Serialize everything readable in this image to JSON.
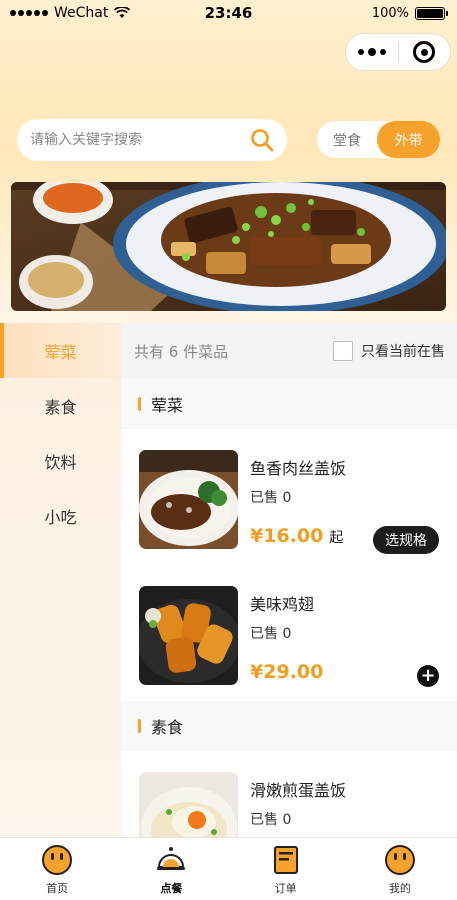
{
  "status_bar": {
    "carrier": "WeChat",
    "time": "23:46",
    "battery": "100%"
  },
  "search": {
    "placeholder": "请输入关键字搜索"
  },
  "mode_toggle": {
    "dine_in": "堂食",
    "takeout": "外带",
    "active": "takeout"
  },
  "categories": [
    {
      "label": "荤菜",
      "active": true
    },
    {
      "label": "素食",
      "active": false
    },
    {
      "label": "饮料",
      "active": false
    },
    {
      "label": "小吃",
      "active": false
    }
  ],
  "filter": {
    "count_text": "共有 6 件菜品",
    "only_on_sale": "只看当前在售"
  },
  "sections": [
    {
      "title": "荤菜",
      "dishes": [
        {
          "name": "鱼香肉丝盖饭",
          "sold": "已售 0",
          "price": "¥16.00",
          "price_suffix": "起",
          "action": "选规格"
        },
        {
          "name": "美味鸡翅",
          "sold": "已售 0",
          "price": "¥29.00",
          "action": "+"
        }
      ]
    },
    {
      "title": "素食",
      "dishes": [
        {
          "name": "滑嫩煎蛋盖饭",
          "sold": "已售 0"
        }
      ]
    }
  ],
  "tabbar": [
    {
      "label": "首页",
      "icon": "face-icon"
    },
    {
      "label": "点餐",
      "icon": "cloche-icon"
    },
    {
      "label": "订单",
      "icon": "order-icon"
    },
    {
      "label": "我的",
      "icon": "face-icon"
    }
  ],
  "colors": {
    "accent": "#f7a22d",
    "price": "#f29d1e"
  }
}
